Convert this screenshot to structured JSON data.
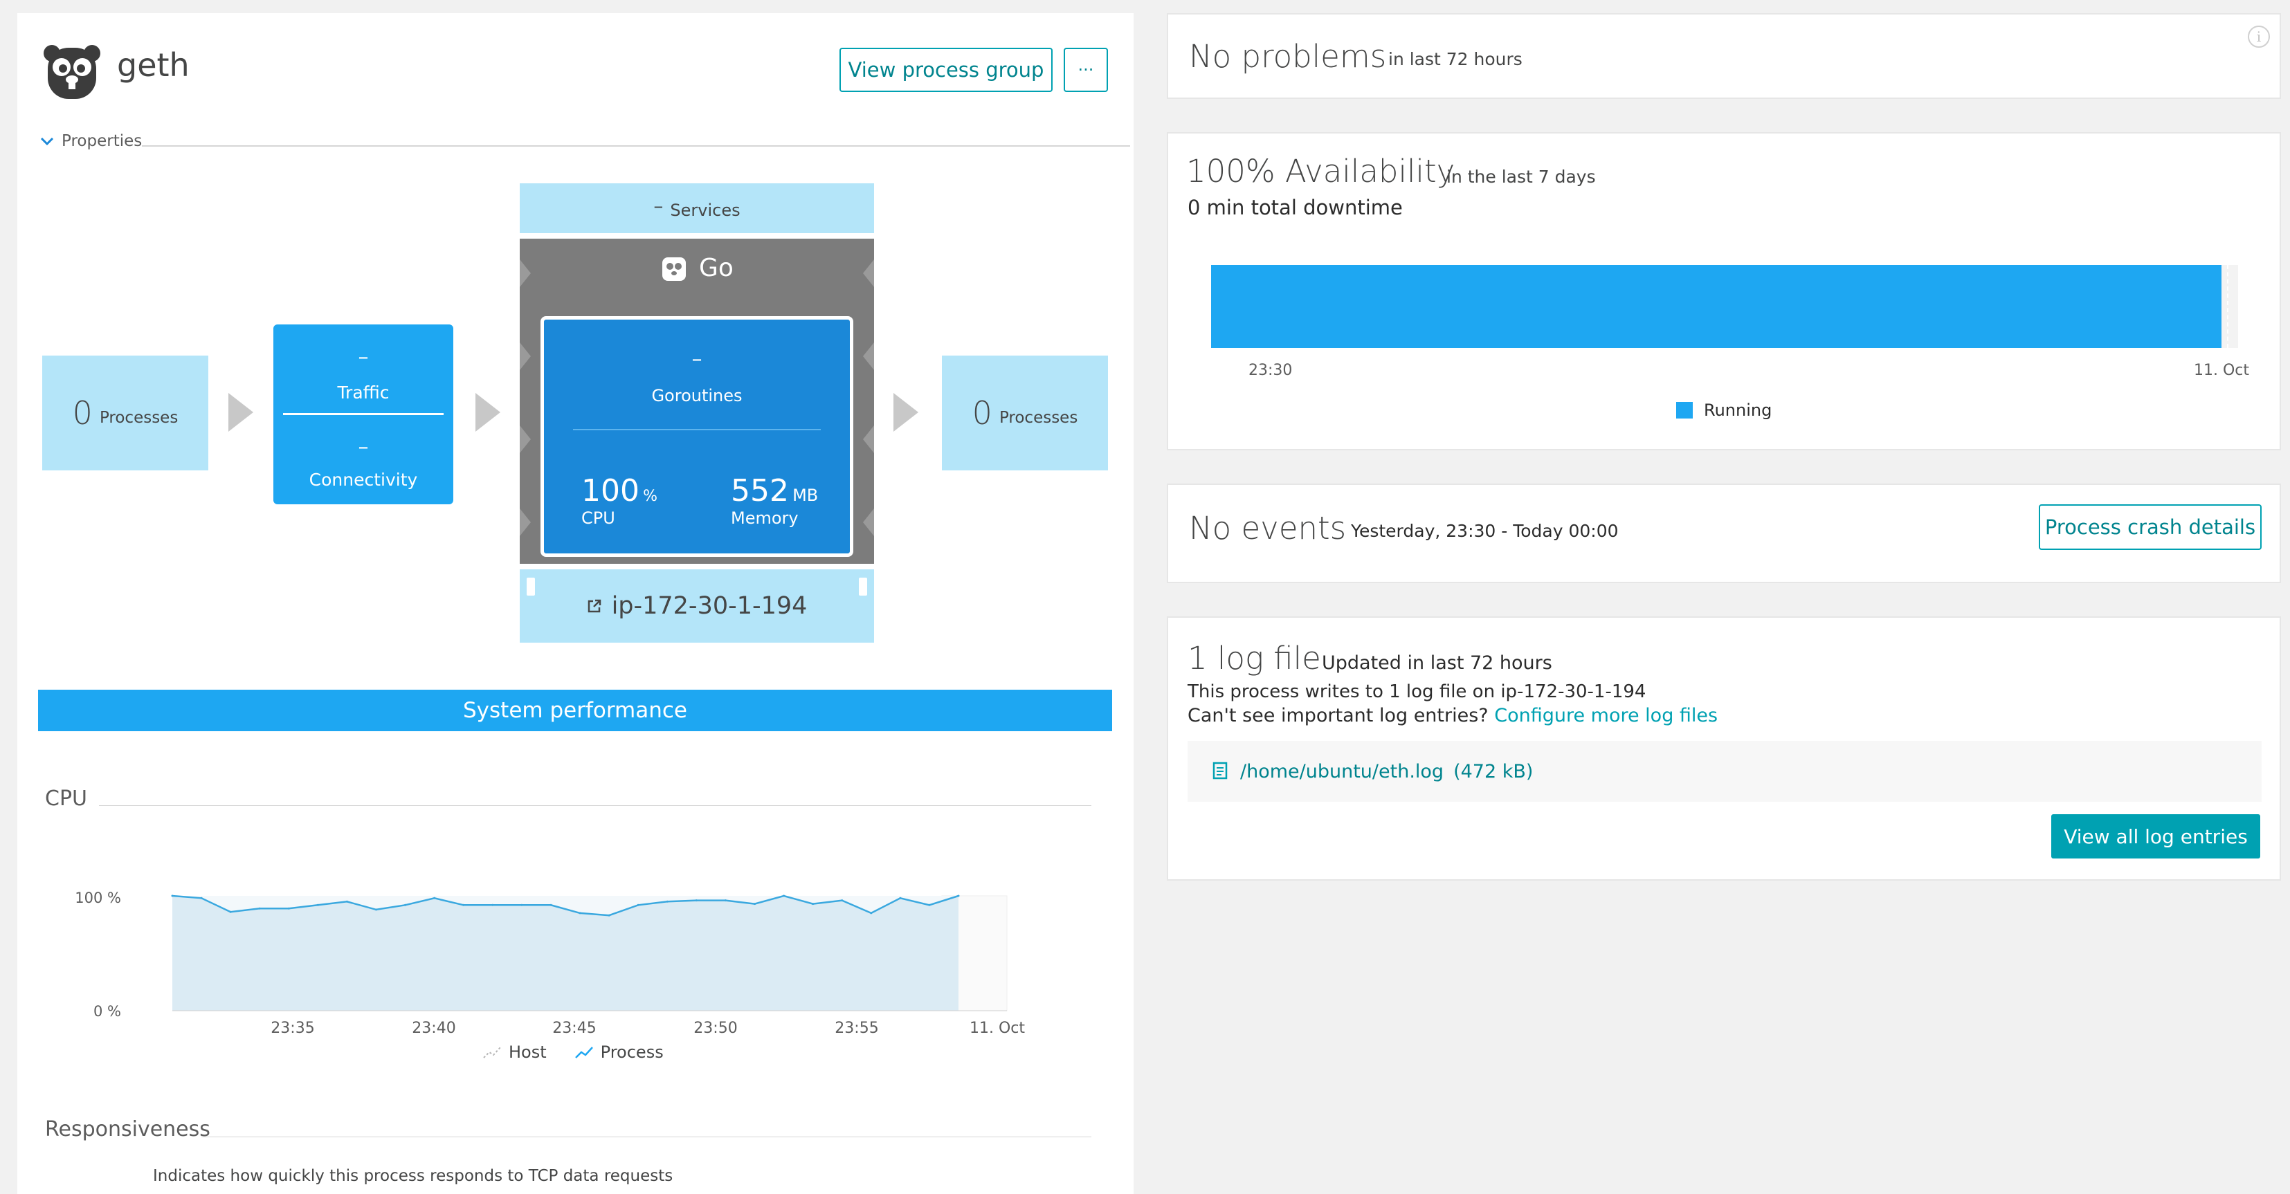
{
  "process": {
    "name": "geth",
    "view_group_label": "View process group",
    "more_label": "···",
    "properties_label": "Properties"
  },
  "flow": {
    "left_count": "0",
    "left_label": "Processes",
    "traffic_value": "–",
    "traffic_label": "Traffic",
    "connectivity_value": "–",
    "connectivity_label": "Connectivity",
    "services_value": "–",
    "services_label": "Services",
    "tech_label": "Go",
    "goroutines_value": "–",
    "goroutines_label": "Goroutines",
    "cpu_value": "100",
    "cpu_unit": "%",
    "cpu_label": "CPU",
    "memory_value": "552",
    "memory_unit": "MB",
    "memory_label": "Memory",
    "host_label": "ip-172-30-1-194",
    "right_count": "0",
    "right_label": "Processes"
  },
  "system_performance": {
    "title": "System performance",
    "cpu_section": "CPU",
    "responsiveness_section": "Responsiveness",
    "responsiveness_desc": "Indicates how quickly this process responds to TCP data requests"
  },
  "chart_data": {
    "type": "area",
    "title": "CPU",
    "y_ticks": [
      "100 %",
      "0 %"
    ],
    "ylim": [
      0,
      100
    ],
    "x_ticks": [
      "23:35",
      "23:40",
      "23:45",
      "23:50",
      "23:55",
      "11. Oct"
    ],
    "series": [
      {
        "name": "Process",
        "values": [
          100,
          98,
          86,
          89,
          89,
          92,
          95,
          88,
          92,
          98,
          92,
          92,
          92,
          92,
          85,
          83,
          92,
          95,
          96,
          96,
          93,
          100,
          93,
          96,
          85,
          98,
          92,
          100
        ]
      }
    ],
    "legend": [
      "Host",
      "Process"
    ],
    "grid": false
  },
  "problems": {
    "title": "No problems",
    "subtitle": "in last 72 hours"
  },
  "availability": {
    "title": "100% Availability",
    "subtitle": "in the last 7 days",
    "downtime": "0 min total downtime",
    "tick_start": "23:30",
    "tick_end": "11. Oct",
    "legend_label": "Running",
    "value_percent": 100,
    "color": "#1ea7f2"
  },
  "events": {
    "title": "No events",
    "range": "Yesterday, 23:30 - Today 00:00",
    "button_label": "Process crash details"
  },
  "logs": {
    "title": "1 log file",
    "updated": "Updated in last 72 hours",
    "desc": "This process writes to 1 log file on ip-172-30-1-194",
    "question": "Can't see important log entries?",
    "configure_link": "Configure more log files",
    "file_path": "/home/ubuntu/eth.log",
    "file_size": "(472 kB)",
    "view_all_label": "View all log entries"
  },
  "colors": {
    "accent": "#1ea7f2",
    "light_blue": "#b4e5f9",
    "teal": "#00a1b2",
    "dark_blue": "#1b88d8",
    "gray": "#7c7c7c"
  }
}
